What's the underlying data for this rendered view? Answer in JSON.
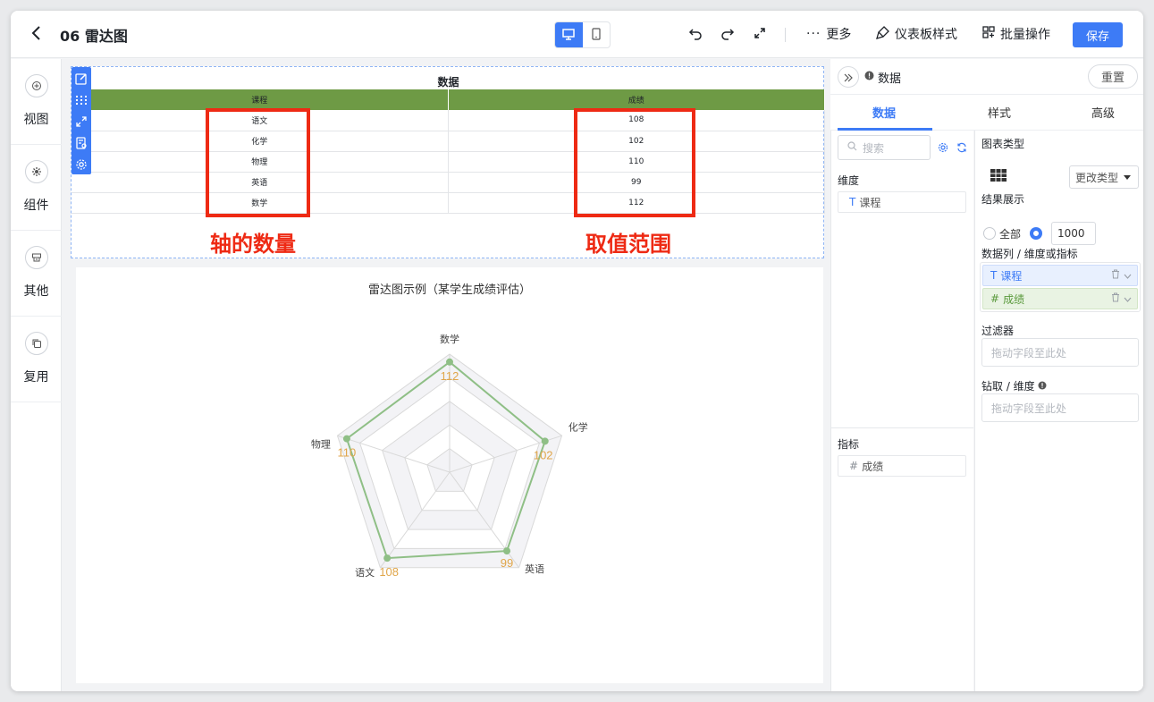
{
  "header": {
    "title": "06 雷达图",
    "more_label": "更多",
    "dashboard_style_label": "仪表板样式",
    "batch_label": "批量操作",
    "save_label": "保存"
  },
  "sidebar": {
    "items": [
      {
        "label": "视图",
        "icon": "plus-circle-icon"
      },
      {
        "label": "组件",
        "icon": "gear-icon"
      },
      {
        "label": "其他",
        "icon": "box-icon"
      },
      {
        "label": "复用",
        "icon": "copy-icon"
      }
    ]
  },
  "table_widget": {
    "title": "数据",
    "columns": [
      "课程",
      "成绩"
    ],
    "rows": [
      [
        "语文",
        "108"
      ],
      [
        "化学",
        "102"
      ],
      [
        "物理",
        "110"
      ],
      [
        "英语",
        "99"
      ],
      [
        "数学",
        "112"
      ]
    ]
  },
  "annotations": {
    "axis_count": "轴的数量",
    "value_range": "取值范围",
    "color": "#ee2a14"
  },
  "chart_data": {
    "type": "radar",
    "title": "雷达图示例（某学生成绩评估）",
    "indicators": [
      "数学",
      "化学",
      "英语",
      "语文",
      "物理"
    ],
    "values": [
      112,
      102,
      99,
      108,
      110
    ],
    "series_color": "#8fbf86",
    "label_color": "#e0a64a",
    "rings": 5
  },
  "right_panel": {
    "name": "数据",
    "reset_label": "重置",
    "tabs": [
      "数据",
      "样式",
      "高级"
    ],
    "search_placeholder": "搜索",
    "dimension_label": "维度",
    "dimension_field": "课程",
    "metric_label": "指标",
    "metric_field": "成绩",
    "chart_type_label": "图表类型",
    "change_type_label": "更改类型",
    "result_label": "结果展示",
    "all_label": "全部",
    "limit_value": "1000",
    "columns_label": "数据列 / 维度或指标",
    "column_dim": "课程",
    "column_mea": "成绩",
    "filter_label": "过滤器",
    "filter_placeholder": "拖动字段至此处",
    "drill_label": "钻取 / 维度",
    "drill_placeholder": "拖动字段至此处",
    "accent_color": "#3d7bf6"
  }
}
